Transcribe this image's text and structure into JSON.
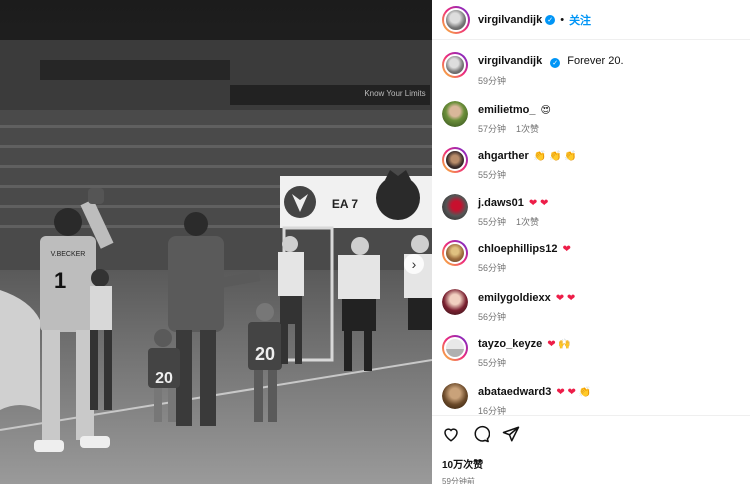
{
  "post": {
    "author": "virgilvandijk",
    "follow_label": "关注",
    "separator": "•",
    "caption": "Forever 20.",
    "caption_time": "59分钟"
  },
  "photo": {
    "jersey_name": "V.BECKER",
    "jersey_number": "1",
    "kid_number_a": "20",
    "kid_number_b": "20",
    "sponsor": "EA 7",
    "banner_text": "Know Your Limits"
  },
  "comments": [
    {
      "user": "emilietmo_",
      "text": "😍",
      "time": "57分钟",
      "likes": "1次赞"
    },
    {
      "user": "ahgarther",
      "text": "👏 👏 👏",
      "time": "55分钟",
      "likes": ""
    },
    {
      "user": "j.daws01",
      "text": "❤ ❤",
      "time": "55分钟",
      "likes": "1次赞"
    },
    {
      "user": "chloephillips12",
      "text": "❤",
      "time": "56分钟",
      "likes": ""
    },
    {
      "user": "emilygoldiexx",
      "text": "❤ ❤",
      "time": "56分钟",
      "likes": ""
    },
    {
      "user": "tayzo_keyze",
      "text": "❤ 🙌",
      "time": "55分钟",
      "likes": ""
    },
    {
      "user": "abataedward3",
      "text": "❤ ❤ 👏",
      "time": "16分钟",
      "likes": ""
    }
  ],
  "footer": {
    "like_count": "10万次赞",
    "posted_time": "59分钟前"
  },
  "colors": {
    "accent": "#0095f6",
    "heart": "#ed1d48"
  }
}
